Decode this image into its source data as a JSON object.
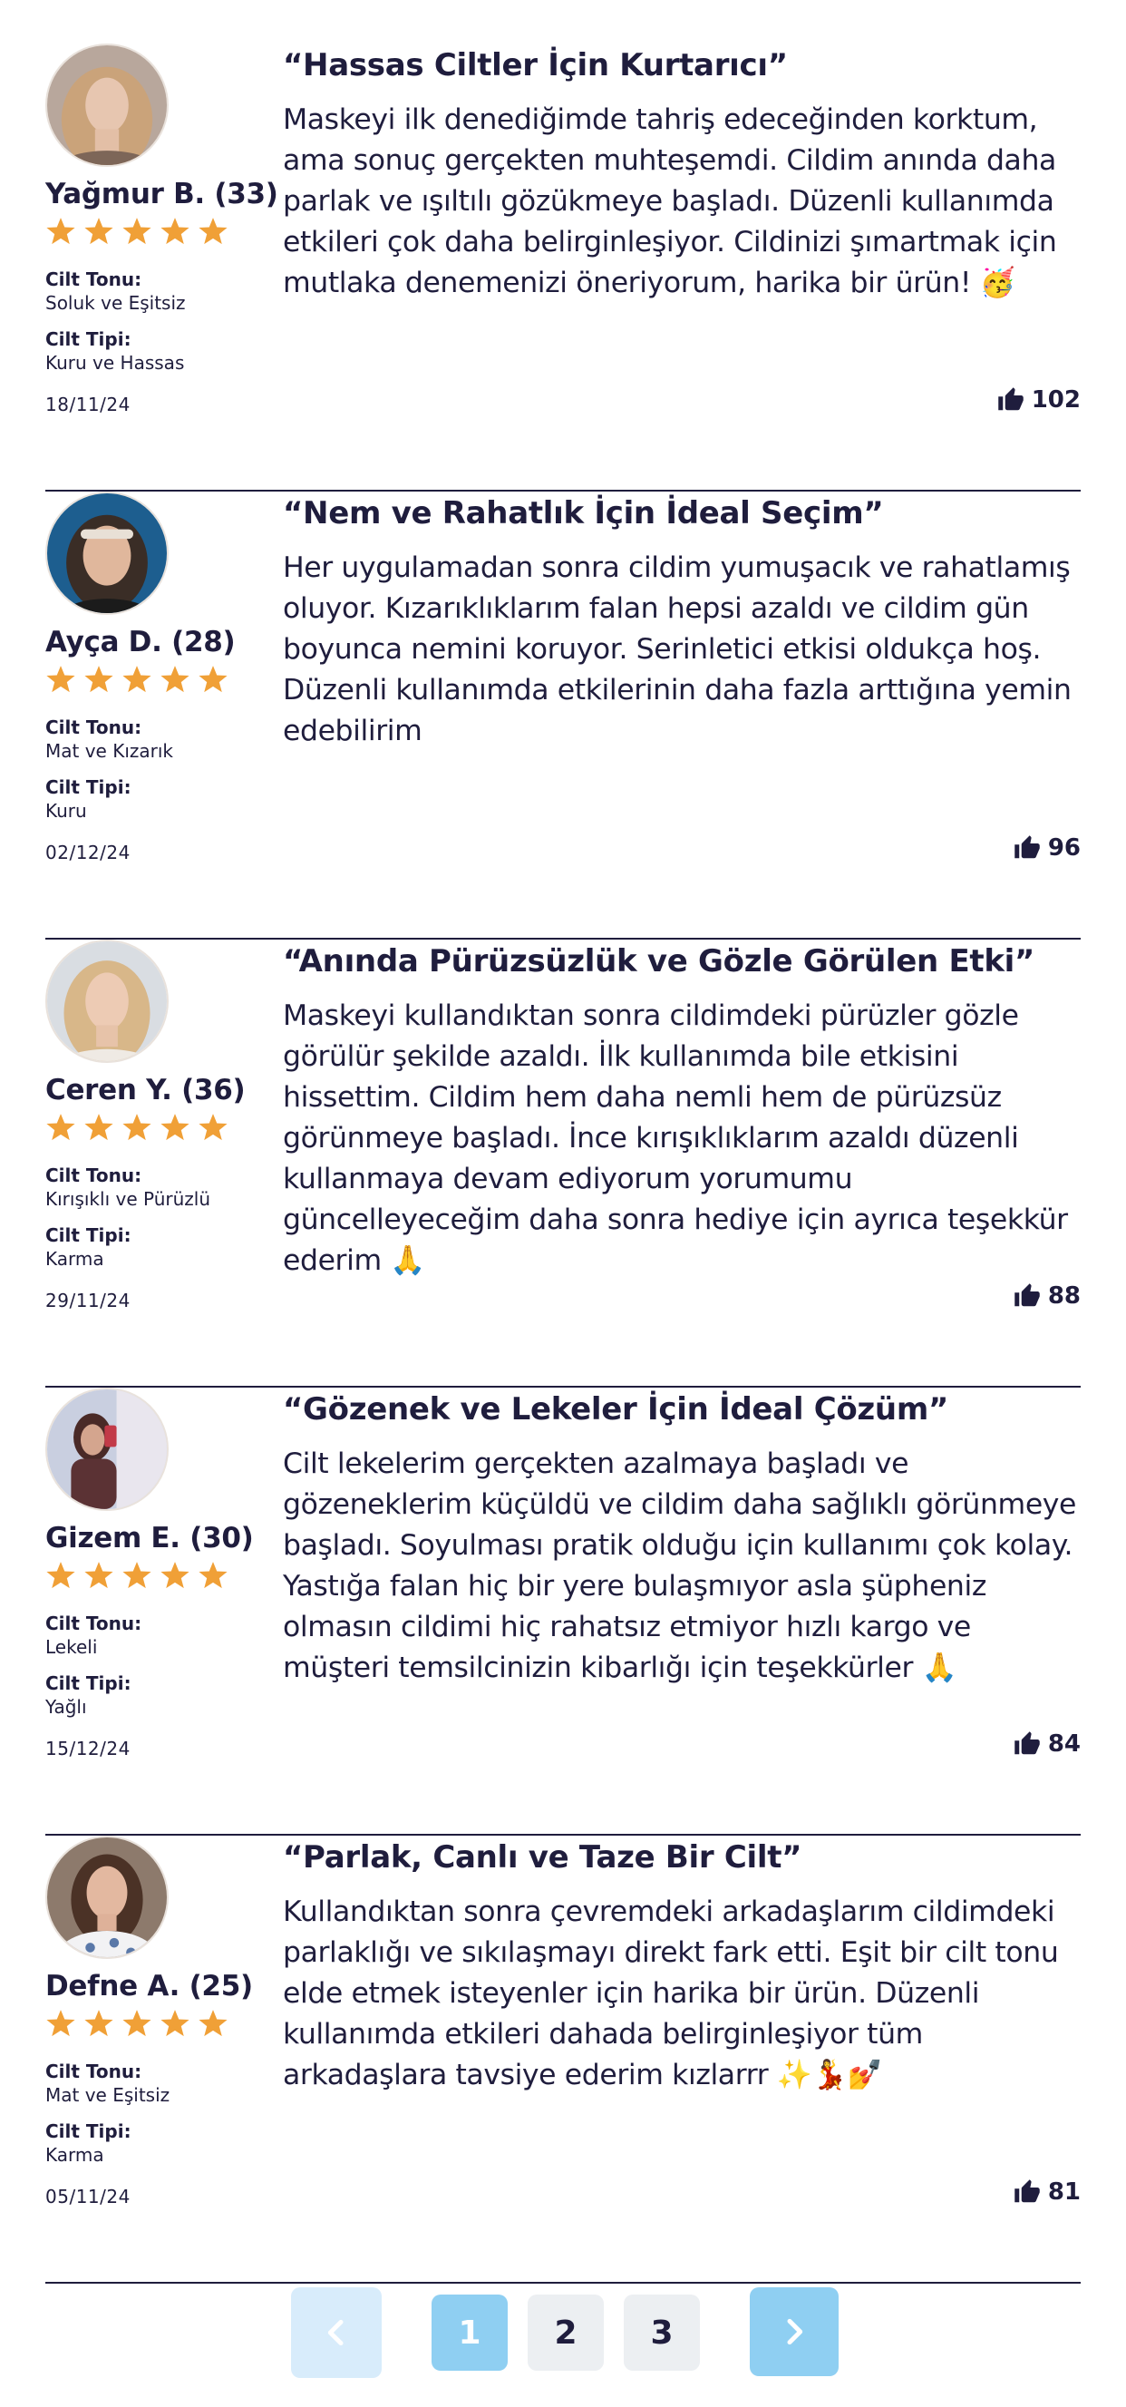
{
  "colors": {
    "text": "#1f1d3d",
    "star": "#f0a037",
    "pager_active": "#8fcff2",
    "pager_prev": "#d8ecfb",
    "pager_inactive": "#eceff2",
    "divider": "#1f1d3d"
  },
  "labels": {
    "skin_tone": "Cilt Tonu:",
    "skin_type": "Cilt Tipi:"
  },
  "reviews": [
    {
      "name": "Yağmur B. (33)",
      "rating": 5,
      "skin_tone": "Soluk ve Eşitsiz",
      "skin_type": "Kuru ve Hassas",
      "date": "18/11/24",
      "title": "“Hassas Ciltler İçin Kurtarıcı”",
      "text": "Maskeyi ilk denediğimde tahriş edeceğinden korktum, ama sonuç gerçekten muhteşemdi. Cildim anında daha parlak ve ışıltılı gözükmeye başladı. Düzenli kullanımda etkileri çok daha belirginleşiyor. Cildinizi şımartmak için mutlaka denemenizi öneriyorum, harika bir ürün! 🥳",
      "likes": "102",
      "avatar_icon": "avatar-blonde-woman"
    },
    {
      "name": "Ayça D. (28)",
      "rating": 5,
      "skin_tone": "Mat ve Kızarık",
      "skin_type": "Kuru",
      "date": "02/12/24",
      "title": "“Nem ve Rahatlık İçin İdeal Seçim”",
      "text": "Her uygulamadan sonra cildim yumuşacık ve rahatlamış oluyor. Kızarıklıklarım falan hepsi azaldı ve cildim gün boyunca nemini koruyor. Serinletici etkisi oldukça hoş. Düzenli kullanımda etkilerinin daha fazla arttığına yemin edebilirim",
      "likes": "96",
      "avatar_icon": "avatar-woman-headband"
    },
    {
      "name": "Ceren Y. (36)",
      "rating": 5,
      "skin_tone": "Kırışıklı ve Pürüzlü",
      "skin_type": "Karma",
      "date": "29/11/24",
      "title": "“Anında Pürüzsüzlük ve Gözle Görülen Etki”",
      "text": "Maskeyi kullandıktan sonra cildimdeki pürüzler gözle görülür şekilde azaldı. İlk kullanımda bile etkisini hissettim. Cildim hem daha nemli hem de pürüzsüz görünmeye başladı. İnce kırışıklıklarım azaldı düzenli kullanmaya devam ediyorum yorumumu güncelleyeceğim daha sonra hediye için ayrıca teşekkür ederim 🙏",
      "likes": "88",
      "avatar_icon": "avatar-blonde-woman"
    },
    {
      "name": "Gizem E. (30)",
      "rating": 5,
      "skin_tone": "Lekeli",
      "skin_type": "Yağlı",
      "date": "15/12/24",
      "title": "“Gözenek ve Lekeler İçin İdeal Çözüm”",
      "text": "Cilt lekelerim gerçekten azalmaya başladı ve gözeneklerim küçüldü ve cildim daha sağlıklı görünmeye başladı. Soyulması pratik olduğu için kullanımı çok kolay. Yastığa falan hiç bir yere bulaşmıyor asla şüpheniz olmasın cildimi hiç rahatsız etmiyor hızlı kargo ve müşteri temsilcinizin kibarlığı için teşekkürler 🙏",
      "likes": "84",
      "avatar_icon": "avatar-woman-mirror-selfie"
    },
    {
      "name": "Defne A. (25)",
      "rating": 5,
      "skin_tone": "Mat ve Eşitsiz",
      "skin_type": "Karma",
      "date": "05/11/24",
      "title": "“Parlak, Canlı ve Taze Bir Cilt”",
      "text": "Kullandıktan sonra çevremdeki arkadaşlarım cildimdeki parlaklığı ve sıkılaşmayı direkt fark etti. Eşit bir cilt tonu elde etmek isteyenler için harika bir ürün. Düzenli kullanımda etkileri dahada belirginleşiyor tüm arkadaşlara tavsiye ederim kızlarrr ✨💃💅",
      "likes": "81",
      "avatar_icon": "avatar-brunette-woman"
    }
  ],
  "pagination": {
    "prev_icon": "chevron-left-icon",
    "next_icon": "chevron-right-icon",
    "pages": [
      "1",
      "2",
      "3"
    ],
    "current_page": "1"
  }
}
